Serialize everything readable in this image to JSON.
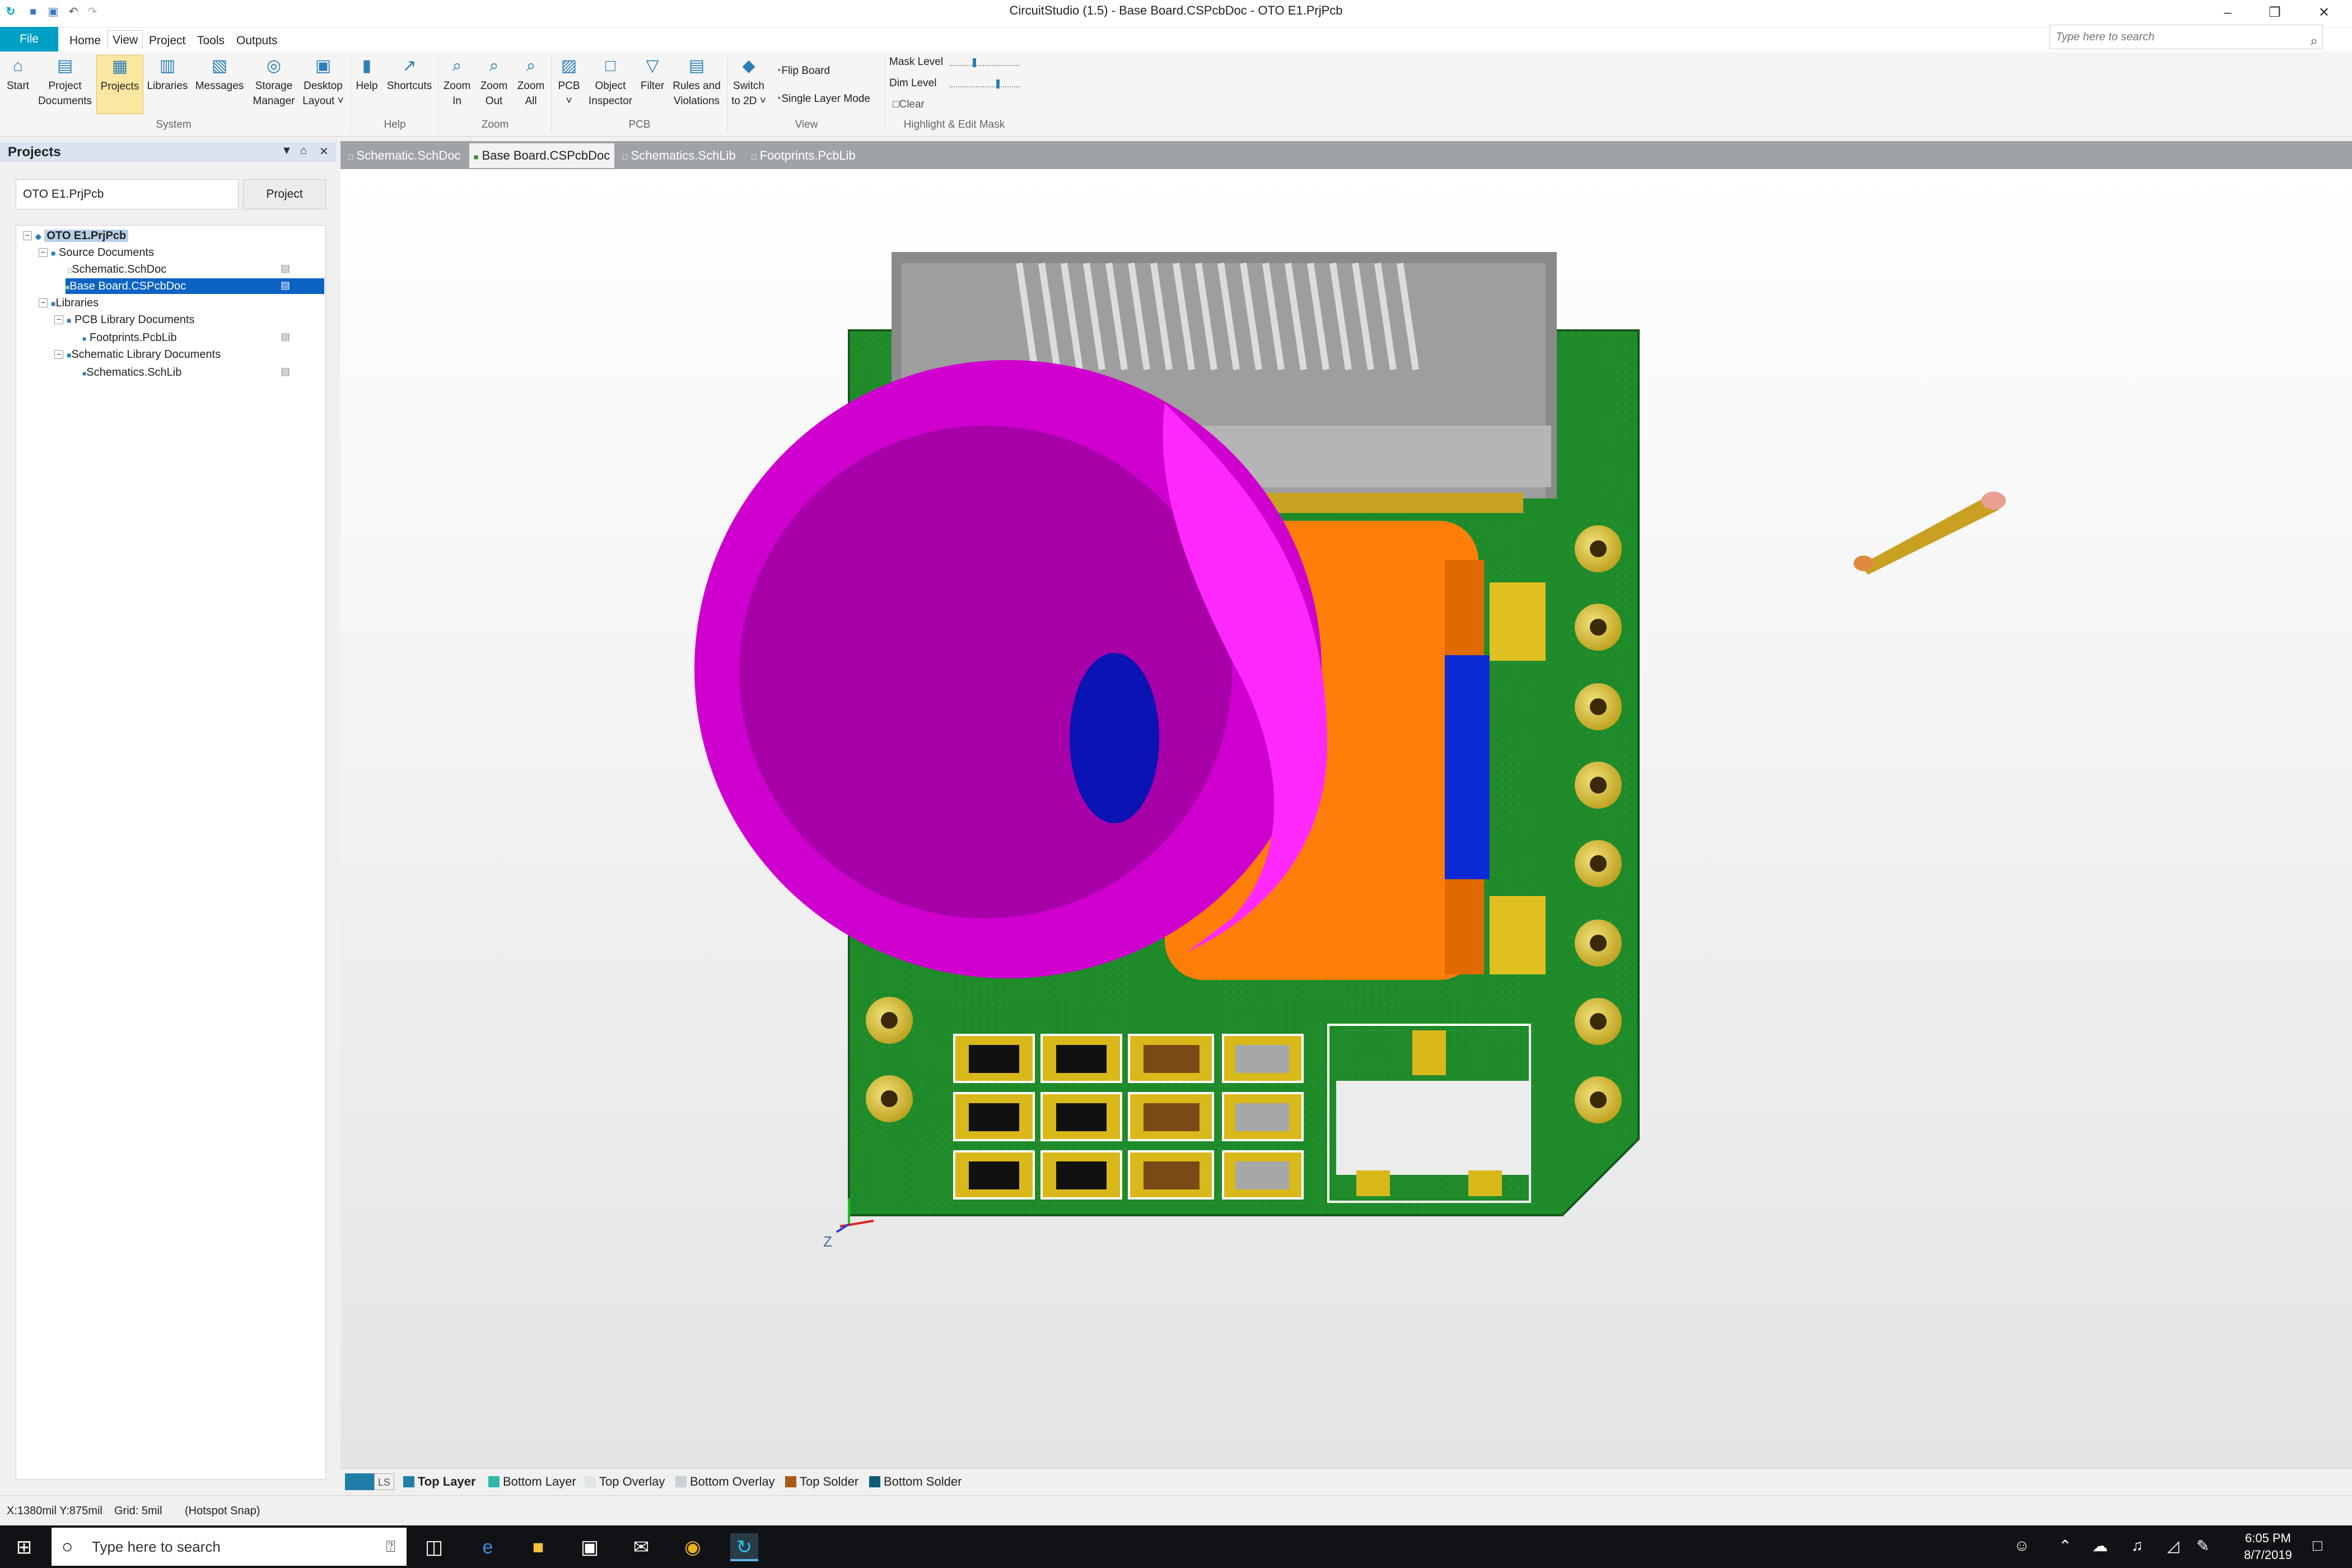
{
  "window": {
    "title": "CircuitStudio (1.5) - Base Board.CSPcbDoc - OTO E1.PrjPcb"
  },
  "search": {
    "placeholder": "Type here to search"
  },
  "menu": {
    "file": "File",
    "items": [
      "Home",
      "View",
      "Project",
      "Tools",
      "Outputs"
    ],
    "active": "View"
  },
  "ribbon": {
    "buttons": [
      {
        "label": "Start",
        "icon": "home-icon"
      },
      {
        "label": "Project\nDocuments",
        "icon": "project-documents-icon"
      },
      {
        "label": "Projects",
        "icon": "projects-icon",
        "selected": true
      },
      {
        "label": "Libraries",
        "icon": "libraries-icon"
      },
      {
        "label": "Messages",
        "icon": "messages-icon"
      },
      {
        "label": "Storage\nManager",
        "icon": "storage-manager-icon"
      },
      {
        "label": "Desktop\nLayout ˅",
        "icon": "desktop-layout-icon"
      },
      {
        "label": "Help",
        "icon": "help-icon"
      },
      {
        "label": "Shortcuts",
        "icon": "shortcuts-icon"
      },
      {
        "label": "Zoom\nIn",
        "icon": "zoom-in-icon"
      },
      {
        "label": "Zoom\nOut",
        "icon": "zoom-out-icon"
      },
      {
        "label": "Zoom\nAll",
        "icon": "zoom-all-icon"
      },
      {
        "label": "PCB\n˅",
        "icon": "pcb-icon"
      },
      {
        "label": "Object\nInspector",
        "icon": "object-inspector-icon"
      },
      {
        "label": "Filter",
        "icon": "filter-icon"
      },
      {
        "label": "Rules and\nViolations",
        "icon": "rules-violations-icon"
      },
      {
        "label": "Switch\nto 2D ˅",
        "icon": "switch-2d-icon"
      }
    ],
    "groups": [
      "System",
      "Help",
      "Zoom",
      "PCB",
      "View",
      "Highlight & Edit Mask"
    ],
    "view_options": [
      "Flip Board",
      "Single Layer Mode"
    ],
    "mask": {
      "mask_level": "Mask Level",
      "dim_level": "Dim Level",
      "clear": "Clear",
      "mask_level_value": 0.35,
      "dim_level_value": 0.7
    }
  },
  "projects_panel": {
    "title": "Projects",
    "input_value": "OTO E1.PrjPcb",
    "project_button": "Project",
    "tree": [
      {
        "label": "OTO E1.PrjPcb",
        "level": 0,
        "bold": true
      },
      {
        "label": "Source Documents",
        "level": 1
      },
      {
        "label": "Schematic.SchDoc",
        "level": 2
      },
      {
        "label": "Base Board.CSPcbDoc",
        "level": 2,
        "selected": true
      },
      {
        "label": "Libraries",
        "level": 1
      },
      {
        "label": "PCB Library Documents",
        "level": 2
      },
      {
        "label": "Footprints.PcbLib",
        "level": 3
      },
      {
        "label": "Schematic Library Documents",
        "level": 2
      },
      {
        "label": "Schematics.SchLib",
        "level": 3
      }
    ]
  },
  "doc_tabs": [
    {
      "label": "Schematic.SchDoc"
    },
    {
      "label": "Base Board.CSPcbDoc",
      "active": true
    },
    {
      "label": "Schematics.SchLib"
    },
    {
      "label": "Footprints.PcbLib"
    }
  ],
  "canvas": {
    "axis_label": "Z"
  },
  "layer_bar": {
    "ls_label": "LS",
    "layers": [
      {
        "name": "Top Layer",
        "color": "#1f7fa8",
        "active": true
      },
      {
        "name": "Bottom Layer",
        "color": "#2fb8a8"
      },
      {
        "name": "Top Overlay",
        "color": "#dfe6ea"
      },
      {
        "name": "Bottom Overlay",
        "color": "#c8d2d6"
      },
      {
        "name": "Top Solder",
        "color": "#a85a1a"
      },
      {
        "name": "Bottom Solder",
        "color": "#105a78"
      }
    ]
  },
  "status": {
    "coords": "X:1380mil Y:875mil",
    "grid": "Grid: 5mil",
    "snap": "(Hotspot Snap)"
  },
  "taskbar": {
    "search_placeholder": "Type here to search",
    "time": "6:05 PM",
    "date": "8/7/2019"
  }
}
